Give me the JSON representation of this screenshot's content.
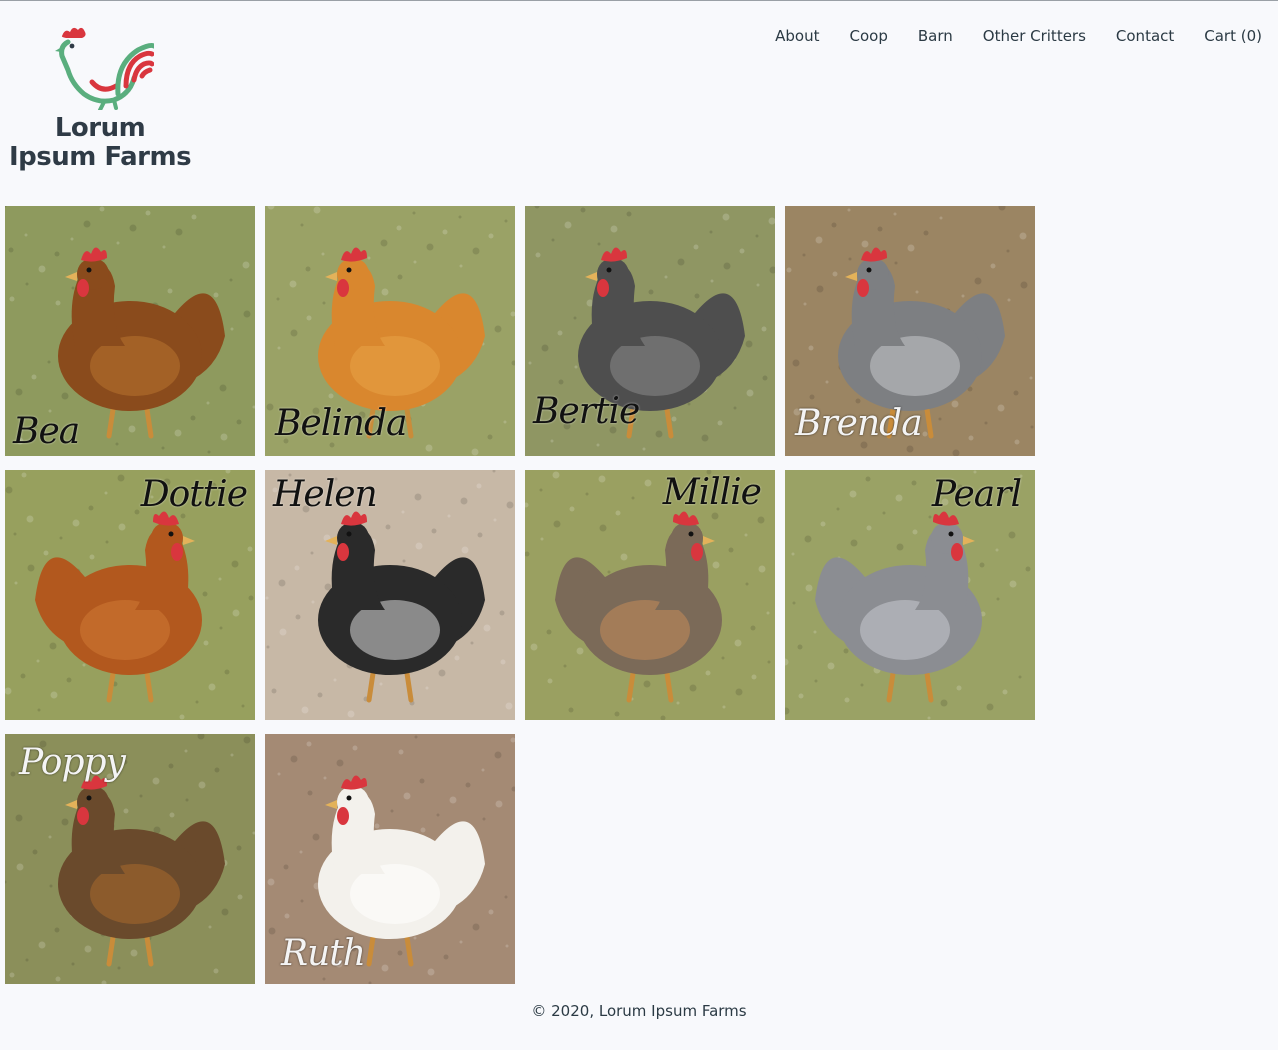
{
  "brand": {
    "line1": "Lorum",
    "line2": "Ipsum Farms",
    "logo_icon": "rooster-icon",
    "colors": {
      "green": "#5aae7e",
      "red": "#d9363e",
      "text": "#2f3b46"
    }
  },
  "nav": {
    "items": [
      {
        "label": "About"
      },
      {
        "label": "Coop"
      },
      {
        "label": "Barn"
      },
      {
        "label": "Other Critters"
      },
      {
        "label": "Contact"
      },
      {
        "label": "Cart (0)"
      }
    ]
  },
  "gallery": {
    "chickens": [
      {
        "name": "Bea",
        "body": "#8a4b1c",
        "accent": "#b8742f",
        "ground": "#8e9a5e",
        "label_pos": "bottom-left",
        "label_tone": "dark"
      },
      {
        "name": "Belinda",
        "body": "#d9872e",
        "accent": "#e8a347",
        "ground": "#9aa266",
        "label_pos": "bottom-left",
        "label_tone": "dark"
      },
      {
        "name": "Bertie",
        "body": "#4e4e4e",
        "accent": "#8a8a8a",
        "ground": "#8f9663",
        "label_pos": "bottom-left",
        "label_tone": "dark"
      },
      {
        "name": "Brenda",
        "body": "#7d7f82",
        "accent": "#c6c8cc",
        "ground": "#9b8563",
        "label_pos": "bottom-left",
        "label_tone": "light"
      },
      {
        "name": "Dottie",
        "body": "#b2581e",
        "accent": "#cf7a35",
        "ground": "#97a05e",
        "label_pos": "top-right",
        "label_tone": "dark"
      },
      {
        "name": "Helen",
        "body": "#2a2a2a",
        "accent": "#d8d8d8",
        "ground": "#c7b8a6",
        "label_pos": "top-left",
        "label_tone": "dark"
      },
      {
        "name": "Millie",
        "body": "#7b6a58",
        "accent": "#c48a5a",
        "ground": "#9aa061",
        "label_pos": "top-right",
        "label_tone": "dark"
      },
      {
        "name": "Pearl",
        "body": "#8b8d92",
        "accent": "#c9cbcf",
        "ground": "#9aa265",
        "label_pos": "top-right",
        "label_tone": "dark"
      },
      {
        "name": "Poppy",
        "body": "#6a4a2c",
        "accent": "#a86a2e",
        "ground": "#8b8f5a",
        "label_pos": "top-left",
        "label_tone": "light"
      },
      {
        "name": "Ruth",
        "body": "#f3f1ec",
        "accent": "#ffffff",
        "ground": "#a48a74",
        "label_pos": "bottom-left",
        "label_tone": "light"
      }
    ]
  },
  "footer": {
    "copyright": "© 2020, Lorum Ipsum Farms"
  }
}
